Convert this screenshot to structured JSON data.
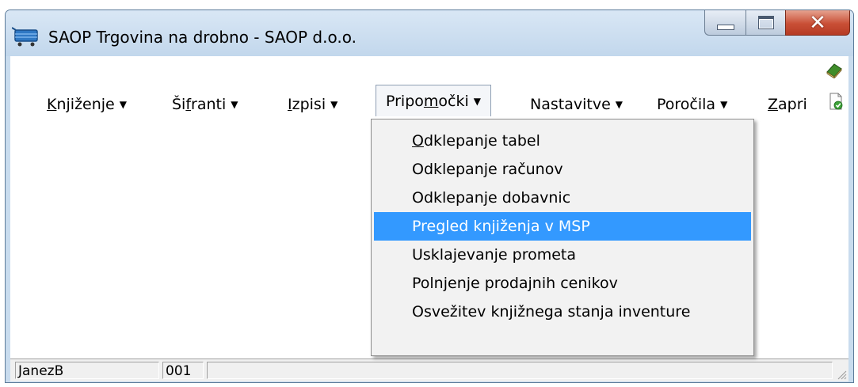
{
  "window": {
    "title": "SAOP Trgovina na drobno - SAOP d.o.o."
  },
  "menubar": {
    "items": [
      {
        "pre": "",
        "u": "K",
        "post": "njiženje",
        "caret": "▼"
      },
      {
        "pre": "Ši",
        "u": "f",
        "post": "ranti",
        "caret": "▼"
      },
      {
        "pre": "",
        "u": "I",
        "post": "zpisi",
        "caret": "▼"
      },
      {
        "pre": "Pripo",
        "u": "m",
        "post": "očki",
        "caret": "▼"
      },
      {
        "pre": "Nastavitve",
        "u": "",
        "post": "",
        "caret": "▼"
      },
      {
        "pre": "Poročila",
        "u": "",
        "post": "",
        "caret": "▼"
      },
      {
        "pre": "",
        "u": "Z",
        "post": "apri",
        "caret": ""
      }
    ]
  },
  "dropdown": {
    "items": [
      {
        "pre": "",
        "u": "O",
        "post": "dklepanje tabel",
        "highlighted": false
      },
      {
        "pre": "Odklepanje računov",
        "u": "",
        "post": "",
        "highlighted": false
      },
      {
        "pre": "Odklepanje dobavnic",
        "u": "",
        "post": "",
        "highlighted": false
      },
      {
        "pre": "Pregled knjiženja v MSP",
        "u": "",
        "post": "",
        "highlighted": true
      },
      {
        "pre": "Usklajevanje prometa",
        "u": "",
        "post": "",
        "highlighted": false
      },
      {
        "pre": "Polnjenje prodajnih cenikov",
        "u": "",
        "post": "",
        "highlighted": false
      },
      {
        "pre": "Osvežitev knjižnega stanja inventure",
        "u": "",
        "post": "",
        "highlighted": false
      }
    ]
  },
  "statusbar": {
    "user": "JanezB",
    "code": "001",
    "extra": ""
  },
  "colors": {
    "highlight": "#3399ff",
    "close_button": "#c94f36"
  },
  "icons": {
    "app": "shopping-cart-icon",
    "minimize": "minimize-icon",
    "maximize": "maximize-icon",
    "close": "close-icon",
    "corner_top": "books-icon",
    "corner_bottom": "document-check-icon"
  }
}
